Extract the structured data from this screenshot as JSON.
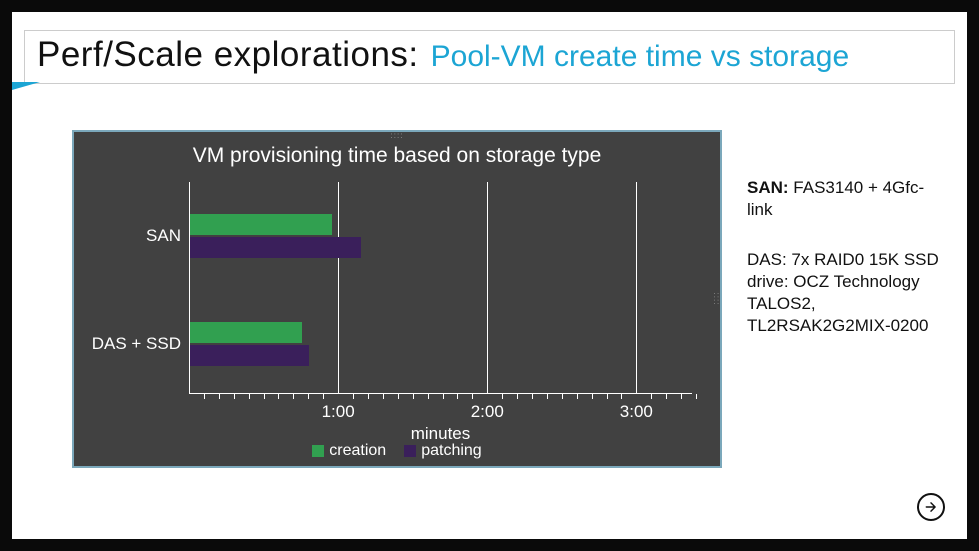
{
  "title": {
    "main": "Perf/Scale explorations:",
    "sub": "Pool-VM create time vs storage"
  },
  "chart_data": {
    "type": "bar",
    "orientation": "horizontal",
    "title": "VM provisioning time based on storage type",
    "xlabel": "minutes",
    "xticks": [
      "1:00",
      "2:00",
      "3:00"
    ],
    "xlim": [
      0,
      3.4
    ],
    "categories": [
      "SAN",
      "DAS + SSD"
    ],
    "series": [
      {
        "name": "creation",
        "color": "#31a050",
        "values": [
          0.95,
          0.75
        ]
      },
      {
        "name": "patching",
        "color": "#3a1f5b",
        "values": [
          1.15,
          0.8
        ]
      }
    ],
    "legend_position": "bottom"
  },
  "sidebar": {
    "san_label": "SAN:",
    "san_text": " FAS3140 + 4Gfc-link",
    "das_text": "DAS: 7x RAID0 15K SSD drive: OCZ Technology TALOS2, TL2RSAK2G2MIX-0200"
  },
  "nav": {
    "next": "Next slide"
  }
}
